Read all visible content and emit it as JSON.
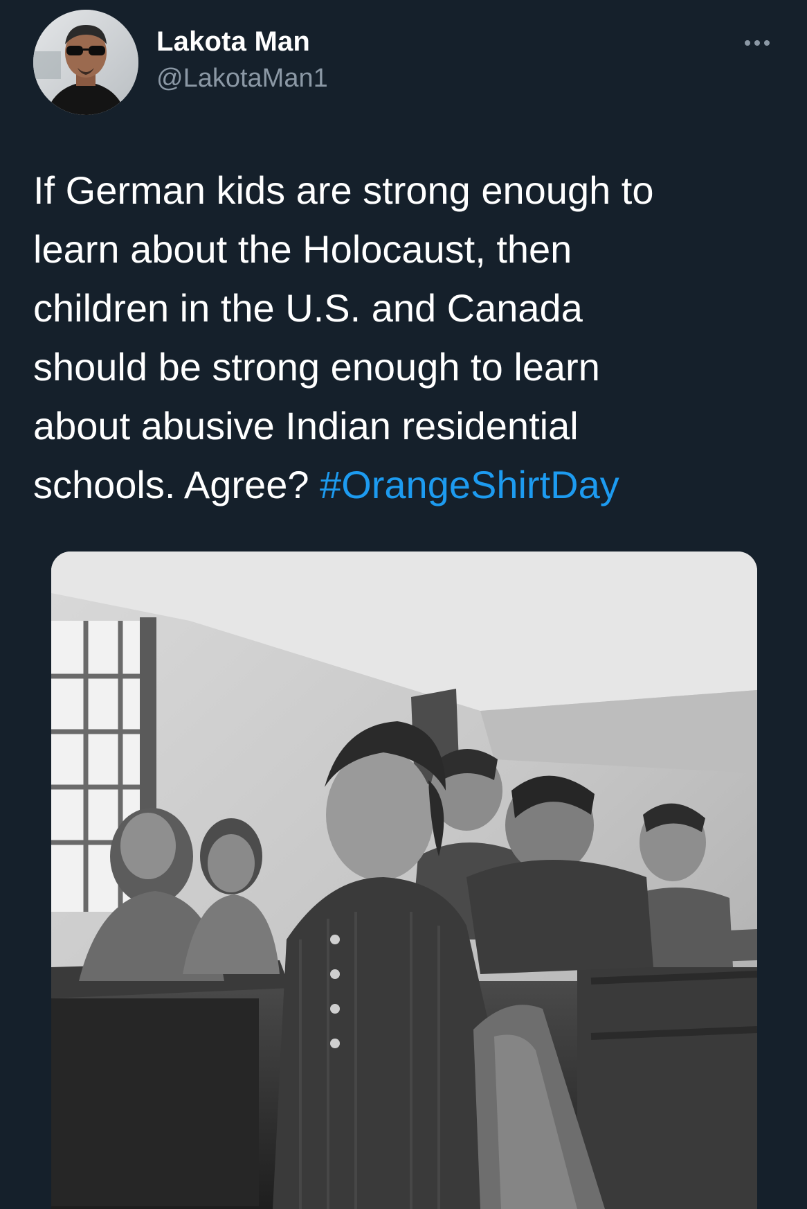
{
  "tweet": {
    "author": {
      "display_name": "Lakota Man",
      "handle": "@LakotaMan1",
      "avatar_icon": "user-avatar-photo"
    },
    "more_icon": "more-horizontal-icon",
    "text_lines": [
      "If German kids are strong enough to",
      "learn about the Holocaust, then",
      "children in the U.S. and Canada",
      "should be strong enough to learn",
      "about abusive Indian residential",
      "schools. Agree? "
    ],
    "hashtag": "#OrangeShirtDay",
    "media": {
      "description_icon": "black-and-white-classroom-photo"
    },
    "colors": {
      "background": "#15202b",
      "text": "#ffffff",
      "secondary": "#8b98a5",
      "link": "#1d9bf0"
    }
  }
}
